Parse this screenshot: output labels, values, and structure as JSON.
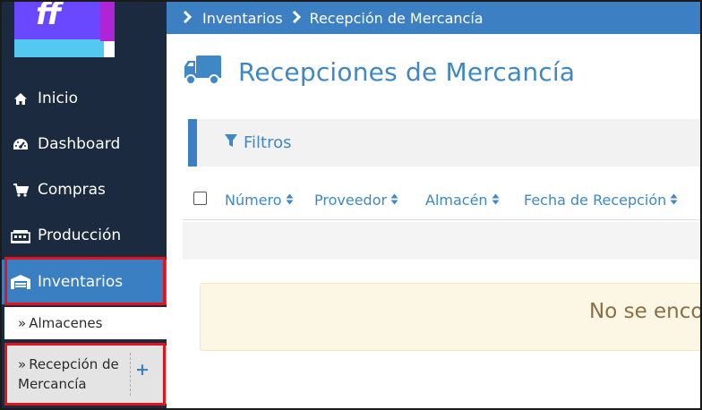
{
  "breadcrumb": {
    "items": [
      "Inventarios",
      "Recepción de Mercancía"
    ]
  },
  "page": {
    "title": "Recepciones de Mercancía",
    "title_icon": "truck-icon"
  },
  "sidebar": {
    "items": [
      {
        "label": "Inicio",
        "icon": "home-icon"
      },
      {
        "label": "Dashboard",
        "icon": "dashboard-icon"
      },
      {
        "label": "Compras",
        "icon": "cart-icon"
      },
      {
        "label": "Producción",
        "icon": "industry-icon"
      },
      {
        "label": "Inventarios",
        "icon": "warehouse-icon"
      }
    ],
    "subitems": [
      {
        "label": "Almacenes"
      },
      {
        "label_line1": "Recepción de",
        "label_line2": "Mercancía",
        "action": "+"
      }
    ]
  },
  "filters": {
    "label": "Filtros",
    "icon": "filter-icon"
  },
  "table": {
    "columns": [
      "Número",
      "Proveedor",
      "Almacén",
      "Fecha de Recepción"
    ]
  },
  "alert": {
    "text": "No se encon"
  },
  "colors": {
    "sidebar_bg": "#1b2a3f",
    "accent": "#3c7fc2",
    "highlight_border": "#e2131b",
    "alert_bg": "#fcf6e4"
  }
}
